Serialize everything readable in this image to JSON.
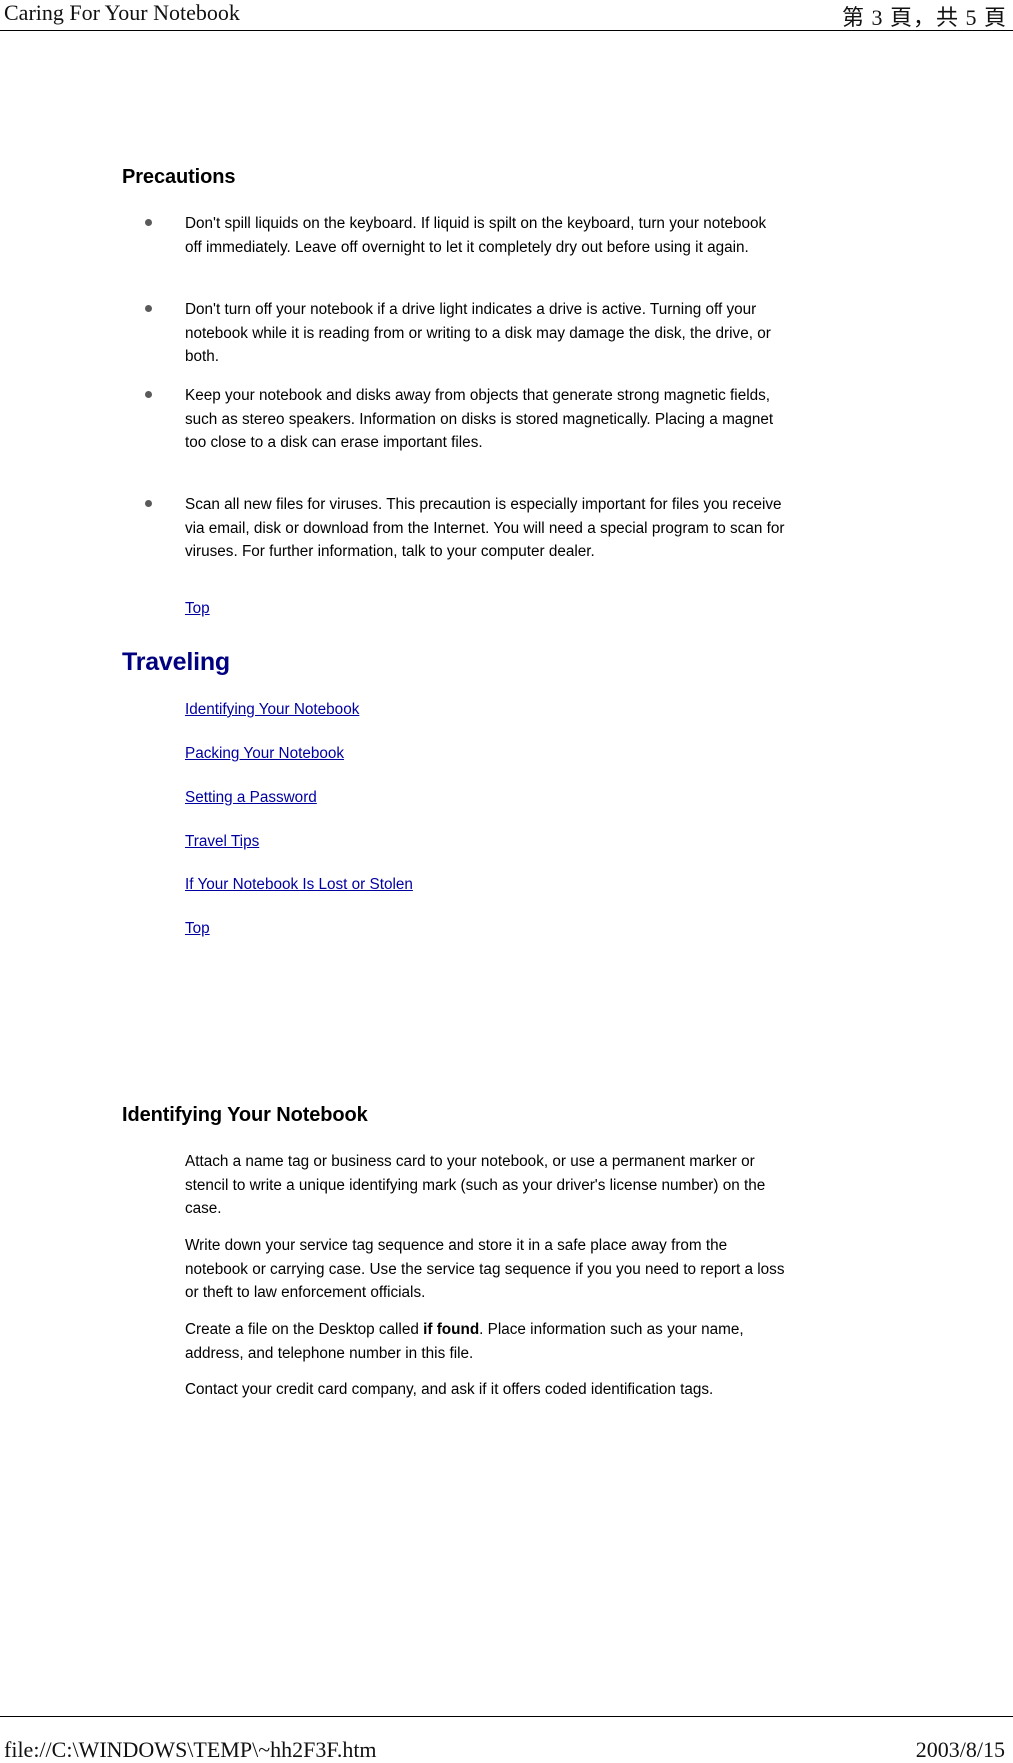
{
  "header": {
    "title": "Caring For Your Notebook",
    "page_indicator": "第 3 頁，共 5 頁"
  },
  "footer": {
    "file_path": "file://C:\\WINDOWS\\TEMP\\~hh2F3F.htm",
    "date": "2003/8/15"
  },
  "colors": {
    "link": "#0000a0",
    "heading_blue": "#000080",
    "heading_black": "#000000",
    "background": "#ffffff"
  },
  "sections": {
    "precautions": {
      "heading": "Precautions",
      "bullets": [
        "Don't spill liquids on the keyboard. If liquid is spilt on the keyboard, turn your notebook off immediately. Leave off overnight to let it completely dry out before using it again.",
        "Don't turn off your notebook if a drive light indicates a drive is active. Turning off your notebook while it is reading from or writing to a disk may damage the disk, the drive, or both.",
        "Keep your notebook and disks away from objects that generate strong magnetic fields, such as stereo speakers. Information on disks is stored magnetically. Placing a magnet too close to a disk can erase important files.",
        "Scan all new files for viruses. This precaution is especially important for files you receive via email, disk or download from the Internet. You will need a special program to scan for viruses. For further information, talk to your computer dealer."
      ],
      "top_link": "Top"
    },
    "traveling": {
      "heading": "Traveling",
      "links": [
        "Identifying Your Notebook",
        "Packing Your Notebook",
        "Setting a Password",
        "Travel Tips",
        "If Your Notebook Is Lost or Stolen"
      ],
      "top_link": "Top"
    },
    "identifying": {
      "heading": "Identifying Your Notebook",
      "paragraphs": [
        {
          "parts": [
            {
              "text": "Attach a name tag or business card to your notebook, or use a permanent marker or stencil to write a unique identifying mark (such as your driver's license number) on the case.",
              "bold": false
            }
          ]
        },
        {
          "parts": [
            {
              "text": "Write down your service tag sequence and store it in a safe place away from the notebook or carrying case. Use the service tag sequence if you you need to report a loss or theft to law enforcement officials.",
              "bold": false
            }
          ]
        },
        {
          "parts": [
            {
              "text": "Create a file on the Desktop called ",
              "bold": false
            },
            {
              "text": "if found",
              "bold": true
            },
            {
              "text": ". Place information such as your name, address, and telephone number in this file.",
              "bold": false
            }
          ]
        },
        {
          "parts": [
            {
              "text": "Contact your credit card company, and ask if it offers coded identification tags.",
              "bold": false
            }
          ]
        }
      ]
    }
  }
}
